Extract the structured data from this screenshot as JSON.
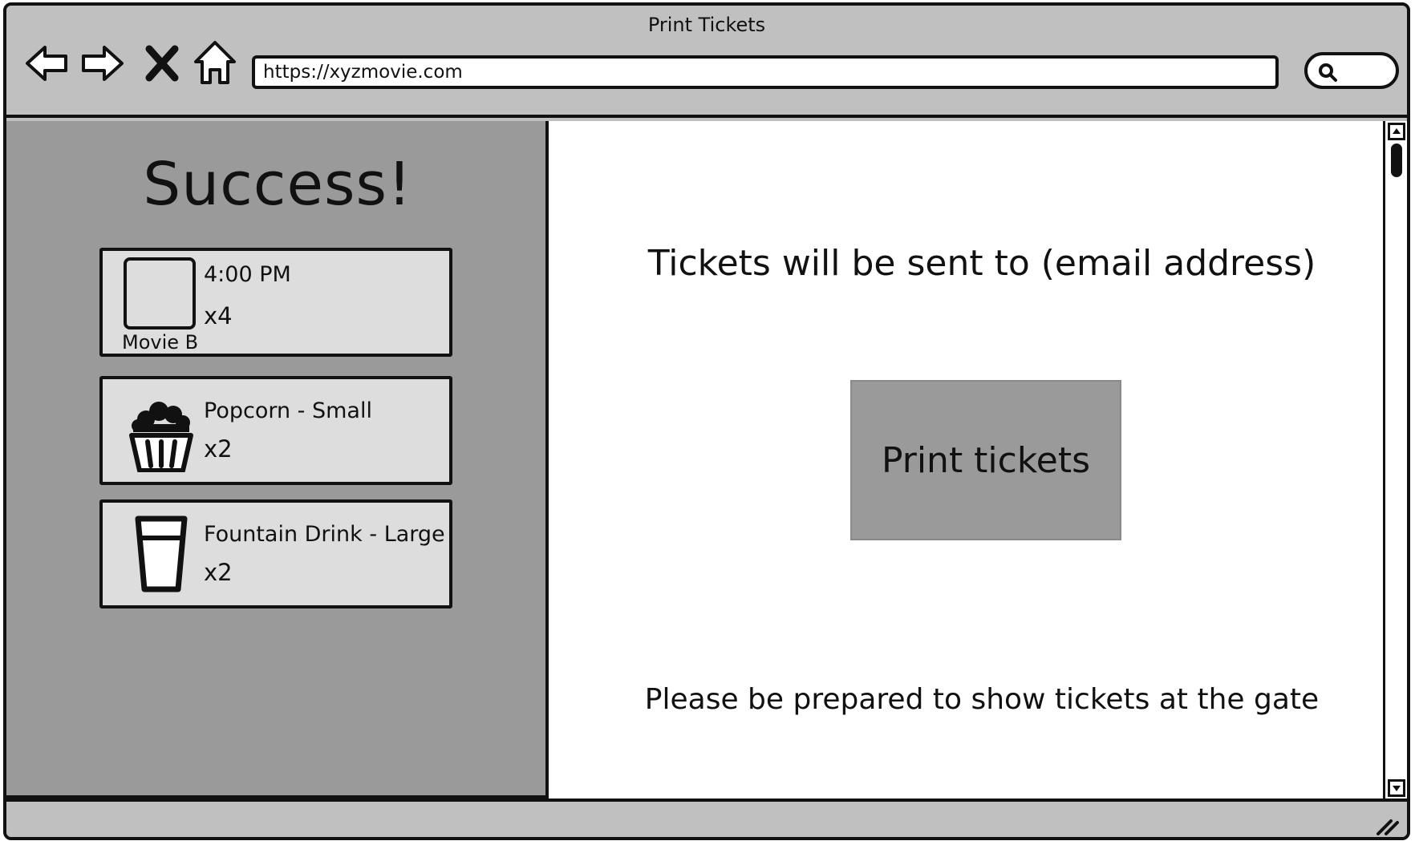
{
  "window": {
    "title": "Print Tickets"
  },
  "browser": {
    "url": "https://xyzmovie.com",
    "icons": {
      "back": "back-arrow-icon",
      "forward": "forward-arrow-icon",
      "stop": "close-icon",
      "home": "home-icon",
      "search": "search-icon"
    }
  },
  "sidebar": {
    "heading": "Success!",
    "items": [
      {
        "type": "movie",
        "poster_caption": "Movie B",
        "time": "4:00 PM",
        "quantity": "x4"
      },
      {
        "type": "snack",
        "icon": "popcorn-icon",
        "name": "Popcorn - Small",
        "quantity": "x2"
      },
      {
        "type": "drink",
        "icon": "drink-cup-icon",
        "name": "Fountain Drink - Large",
        "quantity": "x2"
      }
    ]
  },
  "main": {
    "email_message": "Tickets will be sent to (email address)",
    "print_button_label": "Print tickets",
    "gate_message": "Please be prepared to show tickets at the gate"
  },
  "colors": {
    "chrome": "#c0c0c0",
    "sidebar": "#9a9a9a",
    "card": "#dddddd",
    "button": "#9a9a9a",
    "outline": "#111111"
  }
}
